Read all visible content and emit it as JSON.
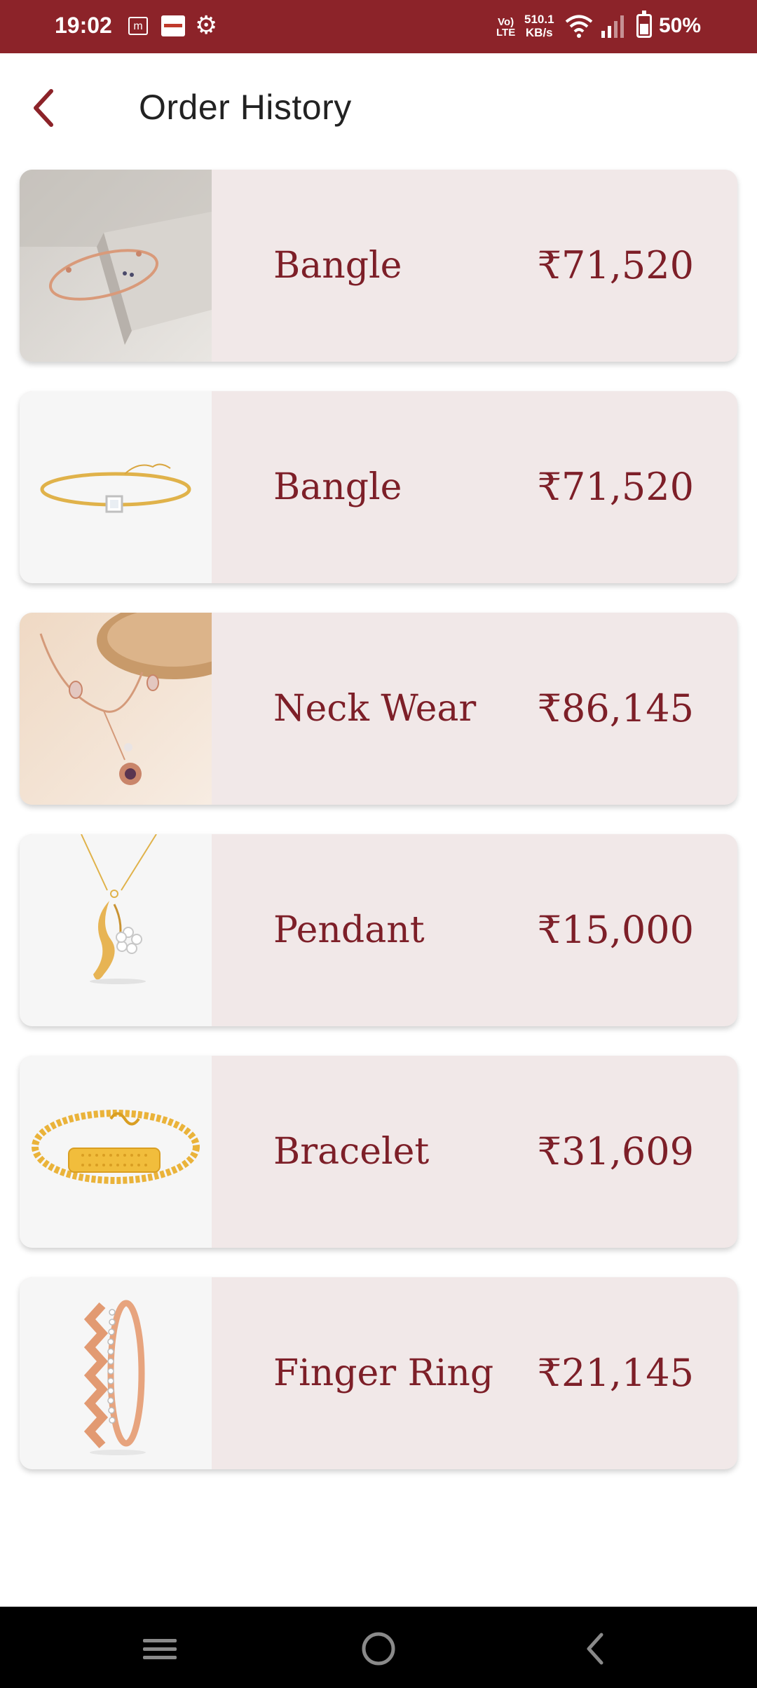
{
  "status_bar": {
    "time": "19:02",
    "lte_top": "Vo)",
    "lte_bottom": "LTE",
    "speed_value": "510.1",
    "speed_unit": "KB/s",
    "battery": "50%"
  },
  "header": {
    "title": "Order History",
    "back_icon": "chevron-left-icon"
  },
  "orders": [
    {
      "name": "Bangle",
      "price": "₹71,520",
      "image": "bangle-rose-gold-photo"
    },
    {
      "name": "Bangle",
      "price": "₹71,520",
      "image": "bangle-gold-photo"
    },
    {
      "name": "Neck Wear",
      "price": "₹86,145",
      "image": "necklace-photo"
    },
    {
      "name": "Pendant",
      "price": "₹15,000",
      "image": "pendant-photo"
    },
    {
      "name": "Bracelet",
      "price": "₹31,609",
      "image": "bracelet-photo"
    },
    {
      "name": "Finger Ring",
      "price": "₹21,145",
      "image": "finger-ring-photo"
    }
  ],
  "colors": {
    "brand": "#8c2329",
    "card_background": "#f1e8e8",
    "text_accent": "#7d1f28"
  }
}
